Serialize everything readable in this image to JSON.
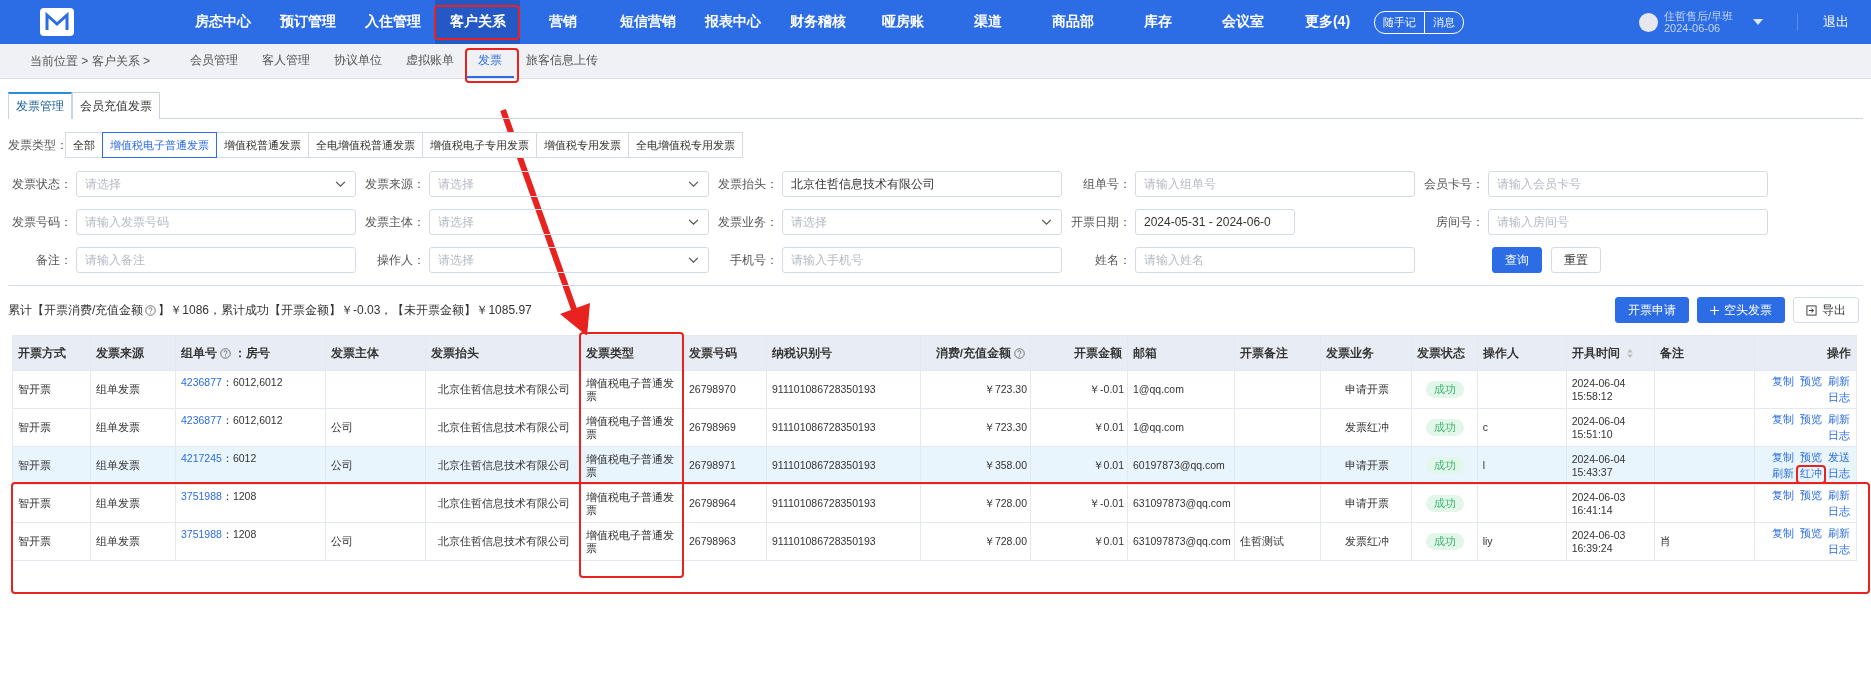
{
  "top_nav": {
    "items": [
      {
        "label": "房态中心",
        "selected": false
      },
      {
        "label": "预订管理",
        "selected": false
      },
      {
        "label": "入住管理",
        "selected": false
      },
      {
        "label": "客户关系",
        "selected": true
      },
      {
        "label": "营销",
        "selected": false
      },
      {
        "label": "短信营销",
        "selected": false
      },
      {
        "label": "报表中心",
        "selected": false
      },
      {
        "label": "财务稽核",
        "selected": false
      },
      {
        "label": "哑房账",
        "selected": false
      },
      {
        "label": "渠道",
        "selected": false
      },
      {
        "label": "商品部",
        "selected": false
      },
      {
        "label": "库存",
        "selected": false
      },
      {
        "label": "会议室",
        "selected": false
      },
      {
        "label": "更多(4)",
        "selected": false
      }
    ],
    "quick_buttons": [
      "随手记",
      "消息"
    ],
    "user": {
      "name": "住哲售后/早班",
      "date": "2024-06-06"
    },
    "logout": "退出"
  },
  "breadcrumb": "当前位置 > 客户关系 >",
  "sub_nav": [
    {
      "label": "会员管理",
      "selected": false
    },
    {
      "label": "客人管理",
      "selected": false
    },
    {
      "label": "协议单位",
      "selected": false
    },
    {
      "label": "虚拟账单",
      "selected": false
    },
    {
      "label": "发票",
      "selected": true
    },
    {
      "label": "旅客信息上传",
      "selected": false
    }
  ],
  "page_tabs": [
    {
      "label": "发票管理",
      "selected": true
    },
    {
      "label": "会员充值发票",
      "selected": false
    }
  ],
  "invoice_type_filter": {
    "label": "发票类型：",
    "options": [
      {
        "label": "全部",
        "selected": false
      },
      {
        "label": "增值税电子普通发票",
        "selected": true
      },
      {
        "label": "增值税普通发票",
        "selected": false
      },
      {
        "label": "全电增值税普通发票",
        "selected": false
      },
      {
        "label": "增值税电子专用发票",
        "selected": false
      },
      {
        "label": "增值税专用发票",
        "selected": false
      },
      {
        "label": "全电增值税专用发票",
        "selected": false
      }
    ]
  },
  "filters": [
    {
      "label": "发票状态：",
      "kind": "select",
      "placeholder": "请选择"
    },
    {
      "label": "发票来源：",
      "kind": "select",
      "placeholder": "请选择"
    },
    {
      "label": "发票抬头：",
      "kind": "input",
      "value": "北京住哲信息技术有限公司"
    },
    {
      "label": "组单号：",
      "kind": "input",
      "placeholder": "请输入组单号"
    },
    {
      "label": "会员卡号：",
      "kind": "input",
      "placeholder": "请输入会员卡号"
    },
    {
      "label": "发票号码：",
      "kind": "input",
      "placeholder": "请输入发票号码"
    },
    {
      "label": "发票主体：",
      "kind": "select",
      "placeholder": "请选择"
    },
    {
      "label": "发票业务：",
      "kind": "select",
      "placeholder": "请选择"
    },
    {
      "label": "开票日期：",
      "kind": "date",
      "value": "2024-05-31 - 2024-06-0"
    },
    {
      "label": "房间号：",
      "kind": "input",
      "placeholder": "请输入房间号"
    },
    {
      "label": "备注：",
      "kind": "input",
      "placeholder": "请输入备注"
    },
    {
      "label": "操作人：",
      "kind": "select",
      "placeholder": "请选择"
    },
    {
      "label": "手机号：",
      "kind": "input",
      "placeholder": "请输入手机号"
    },
    {
      "label": "姓名：",
      "kind": "input",
      "placeholder": "请输入姓名"
    },
    {
      "kind": "buttons",
      "buttons": [
        {
          "label": "查询",
          "primary": true
        },
        {
          "label": "重置",
          "primary": false
        }
      ]
    }
  ],
  "summary": {
    "before_help": "累计【开票消费/充值金额",
    "after_help": "】￥1086，累计成功【开票金额】￥-0.03，【未开票金额】￥1085.97"
  },
  "actions": [
    {
      "label": "开票申请",
      "kind": "primary"
    },
    {
      "label": "空头发票",
      "kind": "add"
    },
    {
      "label": "导出",
      "kind": "export"
    }
  ],
  "table": {
    "columns": [
      {
        "label": "开票方式"
      },
      {
        "label": "发票来源"
      },
      {
        "label": "组单号",
        "kind": "group",
        "help": true,
        "suffix": "：房号"
      },
      {
        "label": "发票主体"
      },
      {
        "label": "发票抬头",
        "kind": "center"
      },
      {
        "label": "发票类型"
      },
      {
        "label": "发票号码"
      },
      {
        "label": "纳税识别号"
      },
      {
        "label": "消费/充值金额",
        "kind": "amount",
        "help": true
      },
      {
        "label": "开票金额",
        "kind": "amount"
      },
      {
        "label": "邮箱"
      },
      {
        "label": "开票备注"
      },
      {
        "label": "发票业务",
        "kind": "center"
      },
      {
        "label": "发票状态",
        "kind": "status"
      },
      {
        "label": "操作人"
      },
      {
        "label": "开具时间",
        "sortable": true
      },
      {
        "label": "备注"
      },
      {
        "label": "操作",
        "kind": "actions"
      }
    ],
    "rows": [
      {
        "selected": false,
        "method": "智开票",
        "source": "组单发票",
        "group_no": "4236877",
        "rooms": "：6012,6012",
        "title": "北京住哲信息技术有限公司",
        "type": "增值税电子普通发票",
        "number": "26798970",
        "tax_id": "911101086728350193",
        "amount": "￥723.30",
        "invoiced": "￥-0.01",
        "email": "1@qq.com",
        "business": "申请开票",
        "status": "成功",
        "time": "2024-06-04 15:58:12",
        "ops": [
          "复制",
          "预览",
          "刷新",
          "日志"
        ]
      },
      {
        "selected": false,
        "method": "智开票",
        "source": "组单发票",
        "group_no": "4236877",
        "rooms": "：6012,6012",
        "entity": "公司",
        "title": "北京住哲信息技术有限公司",
        "type": "增值税电子普通发票",
        "number": "26798969",
        "tax_id": "911101086728350193",
        "amount": "￥723.30",
        "invoiced": "￥0.01",
        "email": "1@qq.com",
        "business": "发票红冲",
        "status": "成功",
        "operator": "c",
        "time": "2024-06-04 15:51:10",
        "ops": [
          "复制",
          "预览",
          "刷新",
          "日志"
        ]
      },
      {
        "selected": true,
        "method": "智开票",
        "source": "组单发票",
        "group_no": "4217245",
        "rooms": "：6012",
        "entity": "公司",
        "title": "北京住哲信息技术有限公司",
        "type": "增值税电子普通发票",
        "number": "26798971",
        "tax_id": "911101086728350193",
        "amount": "￥358.00",
        "invoiced": "￥0.01",
        "email": "60197873@qq.com",
        "business": "申请开票",
        "status": "成功",
        "operator": "l",
        "time": "2024-06-04 15:43:37",
        "ops": [
          "复制",
          "预览",
          "发送",
          "刷新",
          "红冲",
          "日志"
        ]
      },
      {
        "selected": false,
        "method": "智开票",
        "source": "组单发票",
        "group_no": "3751988",
        "rooms": "：1208",
        "title": "北京住哲信息技术有限公司",
        "type": "增值税电子普通发票",
        "number": "26798964",
        "tax_id": "911101086728350193",
        "amount": "￥728.00",
        "invoiced": "￥-0.01",
        "email": "631097873@qq.com",
        "business": "申请开票",
        "status": "成功",
        "time": "2024-06-03 16:41:14",
        "ops": [
          "复制",
          "预览",
          "刷新",
          "日志"
        ]
      },
      {
        "selected": false,
        "method": "智开票",
        "source": "组单发票",
        "group_no": "3751988",
        "rooms": "：1208",
        "entity": "公司",
        "title": "北京住哲信息技术有限公司",
        "type": "增值税电子普通发票",
        "number": "26798963",
        "tax_id": "911101086728350193",
        "amount": "￥728.00",
        "invoiced": "￥0.01",
        "email": "631097873@qq.com",
        "remark": "住哲测试",
        "business": "发票红冲",
        "status": "成功",
        "operator": "liy",
        "time": "2024-06-03 16:39:24",
        "note": "肖",
        "ops": [
          "复制",
          "预览",
          "刷新",
          "日志"
        ]
      }
    ]
  }
}
